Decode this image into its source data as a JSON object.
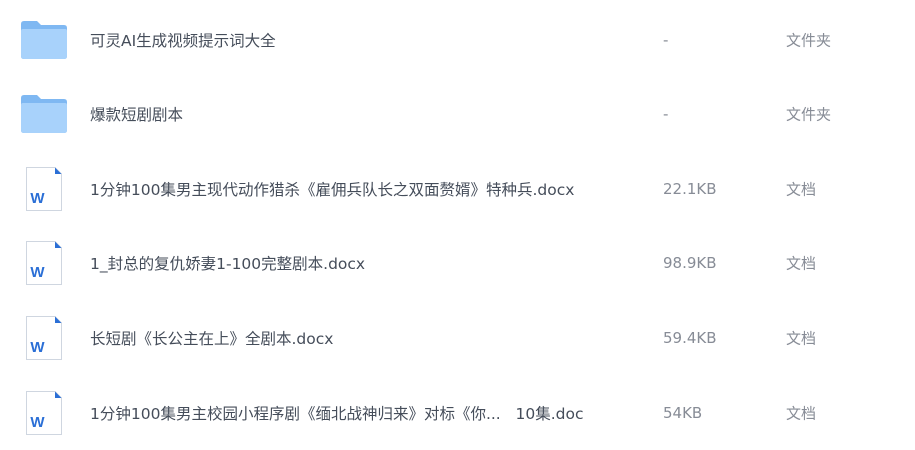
{
  "colors": {
    "folder_back": "#7fb8f2",
    "folder_front": "#a8d2fb",
    "doc_accent": "#2b6fd6",
    "text_primary": "#454d5a",
    "text_secondary": "#878c96"
  },
  "files": [
    {
      "icon": "folder-icon",
      "name": "可灵AI生成视频提示词大全",
      "size": "-",
      "type": "文件夹"
    },
    {
      "icon": "folder-icon",
      "name": "爆款短剧剧本",
      "size": "-",
      "type": "文件夹"
    },
    {
      "icon": "word-doc-icon",
      "icon_letter": "W",
      "name": "1分钟100集男主现代动作猎杀《雇佣兵队长之双面赘婿》特种兵.docx",
      "size": "22.1KB",
      "type": "文档"
    },
    {
      "icon": "word-doc-icon",
      "icon_letter": "W",
      "name": "1_封总的复仇娇妻1-100完整剧本.docx",
      "size": "98.9KB",
      "type": "文档"
    },
    {
      "icon": "word-doc-icon",
      "icon_letter": "W",
      "name": "长短剧《长公主在上》全剧本.docx",
      "size": "59.4KB",
      "type": "文档"
    },
    {
      "icon": "word-doc-icon",
      "icon_letter": "W",
      "name": "1分钟100集男主校园小程序剧《缅北战神归来》对标《你...   10集.doc",
      "size": "54KB",
      "type": "文档"
    }
  ]
}
